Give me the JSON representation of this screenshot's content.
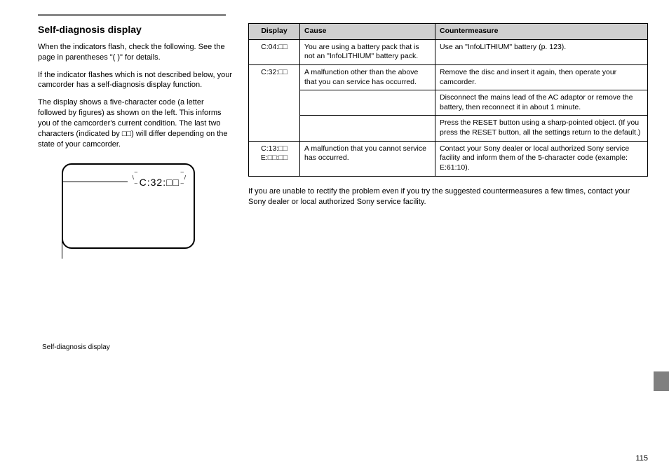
{
  "section": {
    "title": "Self-diagnosis display",
    "p1": "When the indicators flash, check the following. See the page in parentheses \"( )\" for details.",
    "p2": "If the indicator flashes which is not described below, your camcorder has a self-diagnosis display function.",
    "p3_pre": "The display shows a five-character code (a letter followed by figures) as shown on the left. This informs you of the camcorder's current condition. The last two characters (indicated by ",
    "p3_code": "□□",
    "p3_post": ") will differ depending on the state of your camcorder."
  },
  "display": {
    "code": "C:32:□□",
    "label": "Self-diagnosis display"
  },
  "table": {
    "headers": [
      "Display",
      "Cause",
      "Countermeasure"
    ],
    "rows": [
      {
        "display": "C:04:□□",
        "cause": "You are using a battery pack that is not an \"InfoLITHIUM\" battery pack.",
        "counter": "Use an \"InfoLITHIUM\" battery (p. 123)."
      },
      {
        "display": "C:32:□□",
        "rowspan": 3,
        "cause": "A malfunction other than the above that you can service has occurred.",
        "counter": "Remove the disc and insert it again, then operate your camcorder."
      },
      {
        "cause": "",
        "counter": "Disconnect the mains lead of the AC adaptor or remove the battery, then reconnect it in about 1 minute."
      },
      {
        "cause": "",
        "counter": "Press the RESET button using a sharp-pointed object. (If you press the RESET button, all the settings return to the default.)"
      },
      {
        "display": "C:13:□□\nE:□□:□□",
        "cause": "A malfunction that you cannot service has occurred.",
        "counter": "Contact your Sony dealer or local authorized Sony service facility and inform them of the 5-character code (example: E:61:10)."
      }
    ]
  },
  "footer": {
    "note": "If you are unable to rectify the problem even if you try the suggested countermeasures a few times, contact your Sony dealer or local authorized Sony service facility.",
    "page": "115"
  }
}
